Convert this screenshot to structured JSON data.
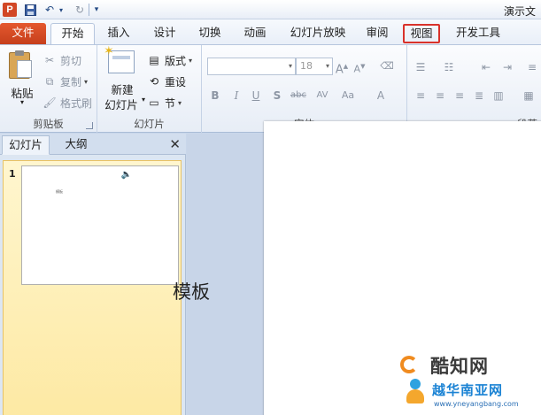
{
  "titlebar": {
    "app_icon_letter": "P",
    "doc_title": "演示文",
    "icons": [
      "save-icon",
      "undo-icon",
      "redo-icon",
      "customize-icon"
    ]
  },
  "tabs": [
    {
      "label": "文件",
      "state": "file"
    },
    {
      "label": "开始",
      "state": "active"
    },
    {
      "label": "插入"
    },
    {
      "label": "设计"
    },
    {
      "label": "切换"
    },
    {
      "label": "动画"
    },
    {
      "label": "幻灯片放映"
    },
    {
      "label": "审阅"
    },
    {
      "label": "视图",
      "state": "highlighted",
      "highlight_color": "#d9322b"
    },
    {
      "label": "开发工具"
    }
  ],
  "ribbon": {
    "clipboard": {
      "paste": "粘贴",
      "cut": "剪切",
      "copy": "复制",
      "format_painter": "格式刷",
      "group_label": "剪贴板"
    },
    "slides": {
      "new_slide_line1": "新建",
      "new_slide_line2": "幻灯片",
      "layout": "版式",
      "reset": "重设",
      "section": "节",
      "group_label": "幻灯片"
    },
    "font": {
      "font_name": "",
      "font_size": "18",
      "buttons": [
        "B",
        "I",
        "U",
        "S",
        "abc",
        "AV",
        "Aa",
        "A"
      ],
      "group_label": "字体"
    },
    "paragraph": {
      "group_label": "段落"
    }
  },
  "left_pane": {
    "tab_slides": "幻灯片",
    "tab_outline": "大纲",
    "close": "✕",
    "slide_number": "1",
    "thumb_text": "模板"
  },
  "slide": {
    "title": "模板"
  },
  "watermark": {
    "line1": "酷知网",
    "line2": "越华南亚网",
    "url": "www.yneyangbang.com"
  },
  "colors": {
    "file_tab": "#d24726",
    "highlight": "#d9322b",
    "ribbon_bg": "#e7edf6"
  }
}
